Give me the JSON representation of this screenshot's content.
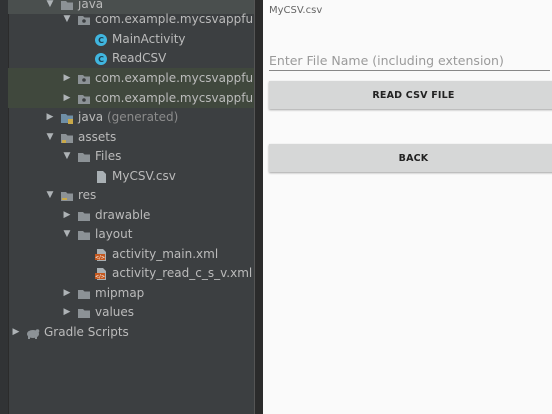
{
  "project_tree": {
    "items": [
      {
        "label": "java",
        "icon": "folder-icon",
        "expanded": true,
        "selected": true
      },
      {
        "label": "com.example.mycsvappfullcode",
        "icon": "package-icon",
        "expanded": true
      },
      {
        "label": "MainActivity",
        "icon": "class-icon"
      },
      {
        "label": "ReadCSV",
        "icon": "class-icon"
      },
      {
        "label": "com.example.mycsvappfullcode",
        "icon": "package-icon",
        "expanded": false
      },
      {
        "label": "com.example.mycsvappfullcode",
        "icon": "package-icon",
        "expanded": false
      },
      {
        "label": "java",
        "suffix": "(generated)",
        "icon": "generated-folder-icon",
        "expanded": false
      },
      {
        "label": "assets",
        "icon": "assets-folder-icon",
        "expanded": true
      },
      {
        "label": "Files",
        "icon": "folder-icon",
        "expanded": true
      },
      {
        "label": "MyCSV.csv",
        "icon": "file-icon"
      },
      {
        "label": "res",
        "icon": "res-folder-icon",
        "expanded": true
      },
      {
        "label": "drawable",
        "icon": "folder-icon",
        "expanded": false
      },
      {
        "label": "layout",
        "icon": "folder-icon",
        "expanded": true
      },
      {
        "label": "activity_main.xml",
        "icon": "xml-layout-icon"
      },
      {
        "label": "activity_read_c_s_v.xml",
        "icon": "xml-layout-icon"
      },
      {
        "label": "mipmap",
        "icon": "folder-icon",
        "expanded": false
      },
      {
        "label": "values",
        "icon": "folder-icon",
        "expanded": false
      },
      {
        "label": "Gradle Scripts",
        "icon": "gradle-icon",
        "expanded": false
      }
    ]
  },
  "app": {
    "file_label": "MyCSV.csv",
    "input_placeholder": "Enter File Name (including extension)",
    "input_value": "",
    "read_button": "READ CSV FILE",
    "back_button": "BACK"
  },
  "colors": {
    "ide_bg": "#3c3f41",
    "text": "#bbbbbb",
    "folder": "#8c9296",
    "class_icon": "#40b6e0",
    "xml_icon": "#c4581f",
    "button_bg": "#d6d7d7",
    "phone_bg": "#fafafa"
  }
}
